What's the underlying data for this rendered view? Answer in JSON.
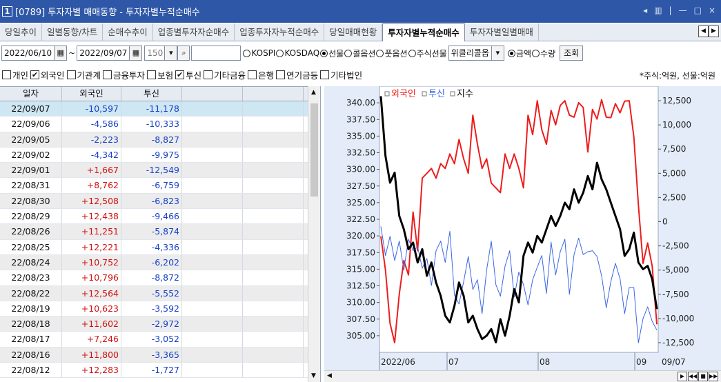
{
  "window": {
    "number": "1",
    "title": "[0789] 투자자별 매매동향 - 투자자별누적순매수",
    "controls": [
      "◂",
      "▥",
      "|",
      "—",
      "□",
      "×"
    ]
  },
  "tabs": [
    "당일추이",
    "일별동향/차트",
    "순매수추이",
    "업종별투자자순매수",
    "업종투자자누적순매수",
    "당일매매현황",
    "투자자별누적순매수",
    "투자자별일별매매"
  ],
  "active_tab": "투자자별누적순매수",
  "toolbar": {
    "start_date": "2022/06/10",
    "tilde": "~",
    "end_date": "2022/09/07",
    "count": "150",
    "market_radios": [
      {
        "label": "KOSPI",
        "on": false
      },
      {
        "label": "KOSDAQ",
        "on": false
      },
      {
        "label": "선물",
        "on": true
      },
      {
        "label": "콜옵션",
        "on": false
      },
      {
        "label": "풋옵션",
        "on": false
      },
      {
        "label": "주식선물",
        "on": false
      }
    ],
    "weekly_select": "위클리콜옵",
    "value_radios": [
      {
        "label": "금액",
        "on": true
      },
      {
        "label": "수량",
        "on": false
      }
    ],
    "query_button": "조회"
  },
  "investors": [
    {
      "label": "개인",
      "checked": false
    },
    {
      "label": "외국인",
      "checked": true
    },
    {
      "label": "기관계",
      "checked": false
    },
    {
      "label": "금융투자",
      "checked": false
    },
    {
      "label": "보험",
      "checked": false
    },
    {
      "label": "투신",
      "checked": true
    },
    {
      "label": "기타금융",
      "checked": false
    },
    {
      "label": "은행",
      "checked": false
    },
    {
      "label": "연기금등",
      "checked": false
    },
    {
      "label": "기타법인",
      "checked": false
    }
  ],
  "unit_note": "*주식:억원, 선물:억원",
  "grid": {
    "headers": [
      "일자",
      "외국인",
      "투신",
      "",
      ""
    ],
    "rows": [
      [
        "22/09/07",
        "-10,597",
        "-11,178"
      ],
      [
        "22/09/06",
        "-4,586",
        "-10,333"
      ],
      [
        "22/09/05",
        "-2,223",
        "-8,827"
      ],
      [
        "22/09/02",
        "-4,342",
        "-9,975"
      ],
      [
        "22/09/01",
        "+1,667",
        "-12,549"
      ],
      [
        "22/08/31",
        "+8,762",
        "-6,759"
      ],
      [
        "22/08/30",
        "+12,508",
        "-6,823"
      ],
      [
        "22/08/29",
        "+12,438",
        "-9,466"
      ],
      [
        "22/08/26",
        "+11,251",
        "-5,874"
      ],
      [
        "22/08/25",
        "+12,221",
        "-4,336"
      ],
      [
        "22/08/24",
        "+10,752",
        "-6,202"
      ],
      [
        "22/08/23",
        "+10,796",
        "-8,872"
      ],
      [
        "22/08/22",
        "+12,564",
        "-5,552"
      ],
      [
        "22/08/19",
        "+10,623",
        "-3,592"
      ],
      [
        "22/08/18",
        "+11,602",
        "-2,972"
      ],
      [
        "22/08/17",
        "+7,246",
        "-3,052"
      ],
      [
        "22/08/16",
        "+11,800",
        "-3,365"
      ],
      [
        "22/08/12",
        "+12,283",
        "-1,727"
      ]
    ]
  },
  "chart_data": {
    "type": "line",
    "legend": [
      "외국인",
      "투신",
      "지수"
    ],
    "colors": {
      "외국인": "#ee1c1c",
      "투신": "#3a66e6",
      "지수": "#000000"
    },
    "left_axis": {
      "ticks": [
        "340.00",
        "337.50",
        "335.00",
        "332.50",
        "330.00",
        "327.50",
        "325.00",
        "322.50",
        "320.00",
        "317.50",
        "315.00",
        "312.50",
        "310.00",
        "307.50",
        "305.00"
      ],
      "range": [
        302.5,
        342.5
      ]
    },
    "right_axis": {
      "ticks": [
        "12,500",
        "10,000",
        "7,500",
        "5,000",
        "2,500",
        "0",
        "-2,500",
        "-5,000",
        "-7,500",
        "-10,000",
        "-12,500"
      ],
      "range": [
        -13500,
        14000
      ]
    },
    "x_labels": [
      "2022/06",
      "07",
      "08",
      "09",
      "09/07"
    ],
    "series": [
      {
        "name": "외국인",
        "values": [
          -1500,
          -5000,
          -10500,
          -12500,
          -7500,
          -4000,
          -5500,
          1000,
          -3000,
          4500,
          5000,
          5500,
          4500,
          6000,
          5500,
          7000,
          6000,
          8500,
          6500,
          5000,
          11000,
          8000,
          5500,
          6500,
          4000,
          3500,
          3000,
          7000,
          5500,
          7000,
          5500,
          3500,
          11000,
          9000,
          12500,
          9500,
          8000,
          11500,
          10000,
          12000,
          12500,
          11000,
          10800,
          12300,
          11800,
          7200,
          11600,
          10600,
          12600,
          10800,
          10750,
          12200,
          11250,
          12450,
          12500,
          8750,
          1700,
          -4300,
          -2200,
          -4600,
          -10600
        ]
      },
      {
        "name": "투신",
        "values": [
          -500,
          -3500,
          -1500,
          -4000,
          -2000,
          -5000,
          -1800,
          -3000,
          -2600,
          -4800,
          -3800,
          -6600,
          -3000,
          -2000,
          -4200,
          -1000,
          -7600,
          -8500,
          -6200,
          -3600,
          -7000,
          -6000,
          -9500,
          -5000,
          -2000,
          -6500,
          -7700,
          -4600,
          -3000,
          -7800,
          -5200,
          -6500,
          -8600,
          -6000,
          -4700,
          -3500,
          -7400,
          -2100,
          -5500,
          -3100,
          -1800,
          -7500,
          -3400,
          -1700,
          -3400,
          -3100,
          -3000,
          -3600,
          -5600,
          -8900,
          -6200,
          -4300,
          -5900,
          -9500,
          -6800,
          -6800,
          -12500,
          -10000,
          -8800,
          -10300,
          -11200
        ]
      },
      {
        "name": "지수",
        "values": [
          341,
          332,
          328,
          329.5,
          323,
          321,
          318,
          319,
          316,
          318,
          314,
          316,
          313,
          311,
          308,
          307,
          309.5,
          313,
          311,
          307,
          308,
          306,
          304.5,
          305,
          306,
          304,
          307.5,
          305,
          308,
          312,
          310,
          317,
          319,
          317.5,
          320,
          319,
          321,
          323,
          321.5,
          323,
          325,
          324,
          327,
          325,
          326.5,
          329,
          327,
          331,
          328.5,
          327,
          325,
          323,
          321,
          317,
          318,
          320.5,
          316,
          315,
          315.5,
          313.5,
          309
        ]
      }
    ]
  }
}
